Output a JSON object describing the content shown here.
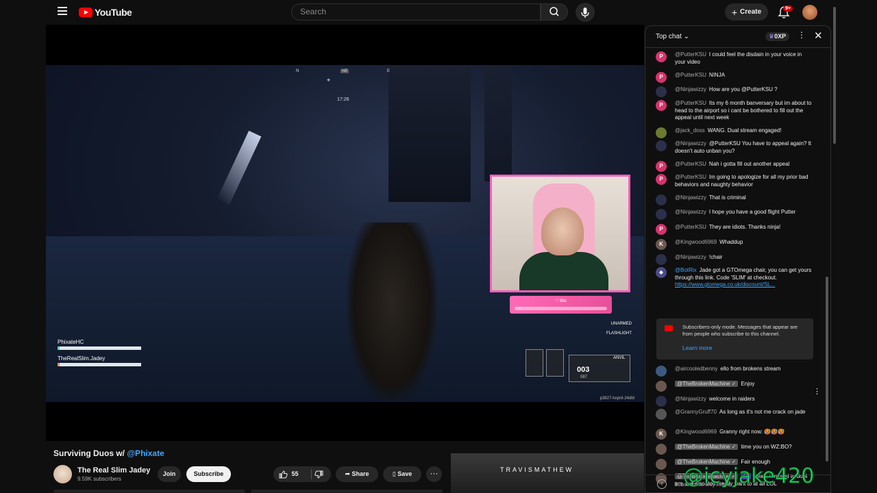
{
  "header": {
    "logo_text": "YouTube",
    "search_placeholder": "Search",
    "create_label": "Create",
    "notif_count": "9+"
  },
  "video": {
    "compass": {
      "n": "N",
      "ne": "NE",
      "e": "E"
    },
    "timer": "17:26",
    "team": [
      {
        "name": "PhixateHC"
      },
      {
        "name": "TheRealSlim.Jadey"
      }
    ],
    "hud": {
      "unarmed": "UNARMED",
      "flashlight": "FLASHLIGHT"
    },
    "ammo": {
      "count": "003",
      "reserve": "087",
      "weapon": "ANVIL"
    },
    "stream_id": "p3827-hxprd-24dbl",
    "bits_label": "♡ Bits"
  },
  "meta": {
    "title_prefix": "Surviving Duos w/ ",
    "title_mention": "@Phixate",
    "channel_name": "The Real Slim Jadey",
    "channel_subs": "9.59K subscribers",
    "join_label": "Join",
    "subscribe_label": "Subscribe",
    "like_count": "55",
    "share_label": "Share",
    "save_label": "Save",
    "more_label": "···"
  },
  "ad": {
    "brand": "TRAVISMATHEW"
  },
  "chat": {
    "mode_label": "Top chat",
    "xp_label": "0XP",
    "messages": [
      {
        "author": "@PutterKSU",
        "text": "I could feel the disdain in your voice in your video",
        "avatar": "P"
      },
      {
        "author": "@PutterKSU",
        "text": "NINJA",
        "avatar": "P"
      },
      {
        "author": "@Ninjawizzy",
        "text": "How are you @PutterKSU ?",
        "avatar": ""
      },
      {
        "author": "@PutterKSU",
        "text": "Its my 6 month banversary but im about to head to the airport so i cant be bothered to fill out the appeal until next week",
        "avatar": "P"
      },
      {
        "author": "@jack_doss",
        "text": "WANG. Dual stream engaged!",
        "avatar": ""
      },
      {
        "author": "@Ninjawizzy",
        "text": "@PutterKSU You have to appeal again? It doesn't auto unban you?",
        "avatar": ""
      },
      {
        "author": "@PutterKSU",
        "text": "Nah i gotta fill out another appeal",
        "avatar": "P"
      },
      {
        "author": "@PutterKSU",
        "text": "Im going to apologize for all my prior bad behaviors and naughty behavior",
        "avatar": "P"
      },
      {
        "author": "@Ninjawizzy",
        "text": "That is criminal",
        "avatar": ""
      },
      {
        "author": "@Ninjawizzy",
        "text": "I hope you have a good flight Putter",
        "avatar": ""
      },
      {
        "author": "@PutterKSU",
        "text": "They are idiots. Thanks ninja!",
        "avatar": "P"
      },
      {
        "author": "@Kingwood6969",
        "text": "Whaddup",
        "avatar": "K"
      },
      {
        "author": "@Ninjawizzy",
        "text": "!chair",
        "avatar": ""
      },
      {
        "author": "@BotRix",
        "text": "Jade got a GTOmega chair, you can get yours through this link. Code 'SLIM' at checkout.",
        "link": "https://www.gtomega.co.uk/discount/SL...",
        "avatar": ""
      }
    ],
    "notice": {
      "text": "Subscribers-only mode. Messages that appear are from people who subscribe to this channel.",
      "learn_more": "Learn more"
    },
    "messages2": [
      {
        "author": "@aircooledbenny",
        "text": "ello from brokens stream"
      },
      {
        "author": "@TheBrokenMachine ✓",
        "text": "Enjoy"
      },
      {
        "author": "@Ninjawizzy",
        "text": "welcome in raiders"
      },
      {
        "author": "@GrannyGruff70",
        "text": "As long as it's not me crack on jade"
      },
      {
        "author": "@Kingwood6969",
        "text": "Granny right now: 🥵🥵🥵"
      },
      {
        "author": "@TheBrokenMachine ✓",
        "text": "time you on WZ:BO?"
      },
      {
        "author": "@TheBrokenMachine ✓",
        "text": "Fair enough"
      },
      {
        "author": "@TheBrokenMachine ✓",
        "rank": "#2",
        "text": "Yeah, tempted to do 4 am, but also don't really want to at all LOL"
      }
    ],
    "input_placeholder": "Subscribers-only mode"
  },
  "watermark": "@icyjake420",
  "colors": {
    "accent": "#ff0000",
    "link": "#3ea6ff",
    "webcam_border": "#ff5fbf",
    "watermark": "#1ddf66"
  }
}
